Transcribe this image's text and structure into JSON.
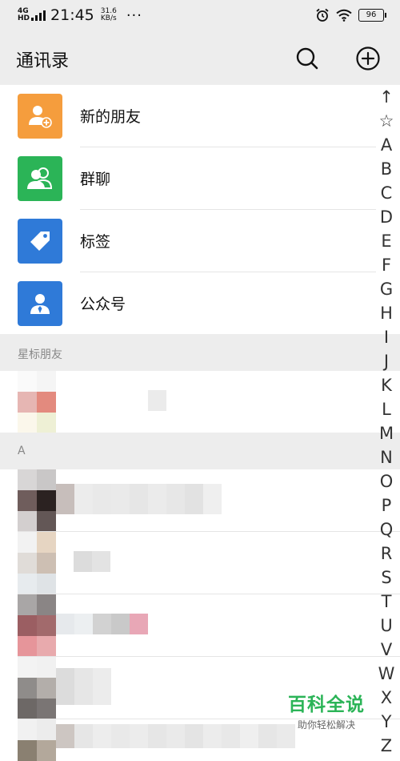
{
  "status_bar": {
    "network": "4G",
    "network_suffix": "HD",
    "time": "21:45",
    "speed_value": "31.6",
    "speed_unit": "KB/s",
    "more": "···",
    "battery": "96"
  },
  "header": {
    "title": "通讯录",
    "search_icon": "search-icon",
    "add_icon": "plus-circle-icon"
  },
  "functions": [
    {
      "label": "新的朋友",
      "icon": "add-friend-icon",
      "color": "#f59d3d"
    },
    {
      "label": "群聊",
      "icon": "group-chat-icon",
      "color": "#2bb457"
    },
    {
      "label": "标签",
      "icon": "tag-icon",
      "color": "#2f7ad8"
    },
    {
      "label": "公众号",
      "icon": "official-account-icon",
      "color": "#2f7ad8"
    }
  ],
  "sections": {
    "starred": "星标朋友",
    "a": "A"
  },
  "index_letters": [
    "↑",
    "☆",
    "A",
    "B",
    "C",
    "D",
    "E",
    "F",
    "G",
    "H",
    "I",
    "J",
    "K",
    "L",
    "M",
    "N",
    "O",
    "P",
    "Q",
    "R",
    "S",
    "T",
    "U",
    "V",
    "W",
    "X",
    "Y",
    "Z"
  ],
  "watermark": {
    "main": "百科全说",
    "sub": "助你轻松解决"
  },
  "colors": {
    "header_bg": "#ededed",
    "accent_green": "#2bb457",
    "orange": "#f59d3d",
    "blue": "#2f7ad8"
  }
}
